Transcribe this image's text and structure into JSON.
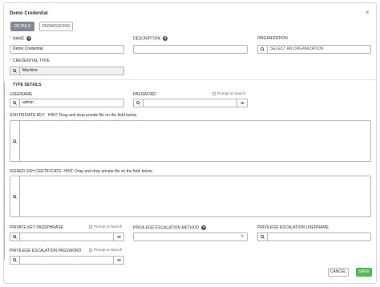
{
  "header": {
    "title": "Demo Credential"
  },
  "tabs": [
    {
      "label": "DETAILS"
    },
    {
      "label": "PERMISSIONS"
    }
  ],
  "fields": {
    "name": {
      "label": "NAME",
      "value": "Demo Credential"
    },
    "description": {
      "label": "DESCRIPTION",
      "value": ""
    },
    "organization": {
      "label": "ORGANIZATION",
      "placeholder": "SELECT AN ORGANIZATION"
    },
    "credential_type": {
      "label": "CREDENTIAL TYPE",
      "value": "Machine"
    }
  },
  "type_details": {
    "heading": "TYPE DETAILS",
    "username": {
      "label": "USERNAME",
      "value": "admin"
    },
    "password": {
      "label": "PASSWORD",
      "value": "",
      "prompt_label": "Prompt on launch"
    },
    "ssh_private_key": {
      "label": "SSH PRIVATE KEY",
      "hint": "HINT: Drag and drop private file on the field below."
    },
    "signed_ssh_certificate": {
      "label": "SIGNED SSH CERTIFICATE",
      "hint": "HINT: Drag and drop private file on the field below."
    },
    "private_key_passphrase": {
      "label": "PRIVATE KEY PASSPHRASE",
      "prompt_label": "Prompt on launch"
    },
    "privilege_escalation_method": {
      "label": "PRIVILEGE ESCALATION METHOD",
      "value": ""
    },
    "privilege_escalation_username": {
      "label": "PRIVILEGE ESCALATION USERNAME",
      "value": ""
    },
    "privilege_escalation_password": {
      "label": "PRIVILEGE ESCALATION PASSWORD",
      "prompt_label": "Prompt on launch"
    }
  },
  "actions": {
    "cancel": "CANCEL",
    "save": "SAVE"
  },
  "icons": {
    "search": "search-icon",
    "eye": "eye-icon",
    "help": "help-icon",
    "close": "close-icon",
    "caret": "caret-down-icon"
  },
  "colors": {
    "save_green": "#5cb85c",
    "active_tab": "#848992",
    "required": "#d9534f"
  }
}
